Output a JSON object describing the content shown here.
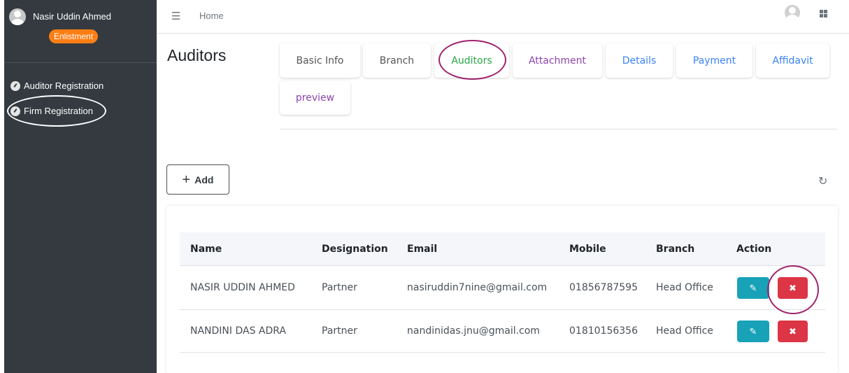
{
  "sidebar": {
    "username": "Nasir Uddin Ahmed",
    "badge": "Enlistment",
    "items": [
      {
        "label": "Auditor Registration",
        "icon": "dashboard-icon"
      },
      {
        "label": "Firm Registration",
        "icon": "dashboard-icon"
      }
    ]
  },
  "topbar": {
    "home": "Home",
    "menu_icon": "hamburger-icon",
    "apps_icon": "grid-icon",
    "avatar_icon": "user-avatar-icon"
  },
  "page": {
    "title": "Auditors"
  },
  "tabs": [
    {
      "label": "Basic Info"
    },
    {
      "label": "Branch"
    },
    {
      "label": "Auditors"
    },
    {
      "label": "Attachment"
    },
    {
      "label": "Details"
    },
    {
      "label": "Payment"
    },
    {
      "label": "Affidavit"
    },
    {
      "label": "preview"
    }
  ],
  "actions": {
    "add_label": "Add",
    "refresh_icon": "refresh-icon"
  },
  "table": {
    "headers": [
      "Name",
      "Designation",
      "Email",
      "Mobile",
      "Branch",
      "Action"
    ],
    "rows": [
      {
        "name": "NASIR UDDIN AHMED",
        "designation": "Partner",
        "email": "nasiruddin7nine@gmail.com",
        "mobile": "01856787595",
        "branch": "Head Office"
      },
      {
        "name": "NANDINI DAS ADRA",
        "designation": "Partner",
        "email": "nandinidas.jnu@gmail.com",
        "mobile": "01810156356",
        "branch": "Head Office"
      }
    ]
  },
  "colors": {
    "sidebar": "#343a40",
    "badge": "#fd7e14",
    "edit": "#17a2b8",
    "delete": "#dc3545",
    "active_tab": "#28a745",
    "highlight_circle": "#a0246e"
  }
}
